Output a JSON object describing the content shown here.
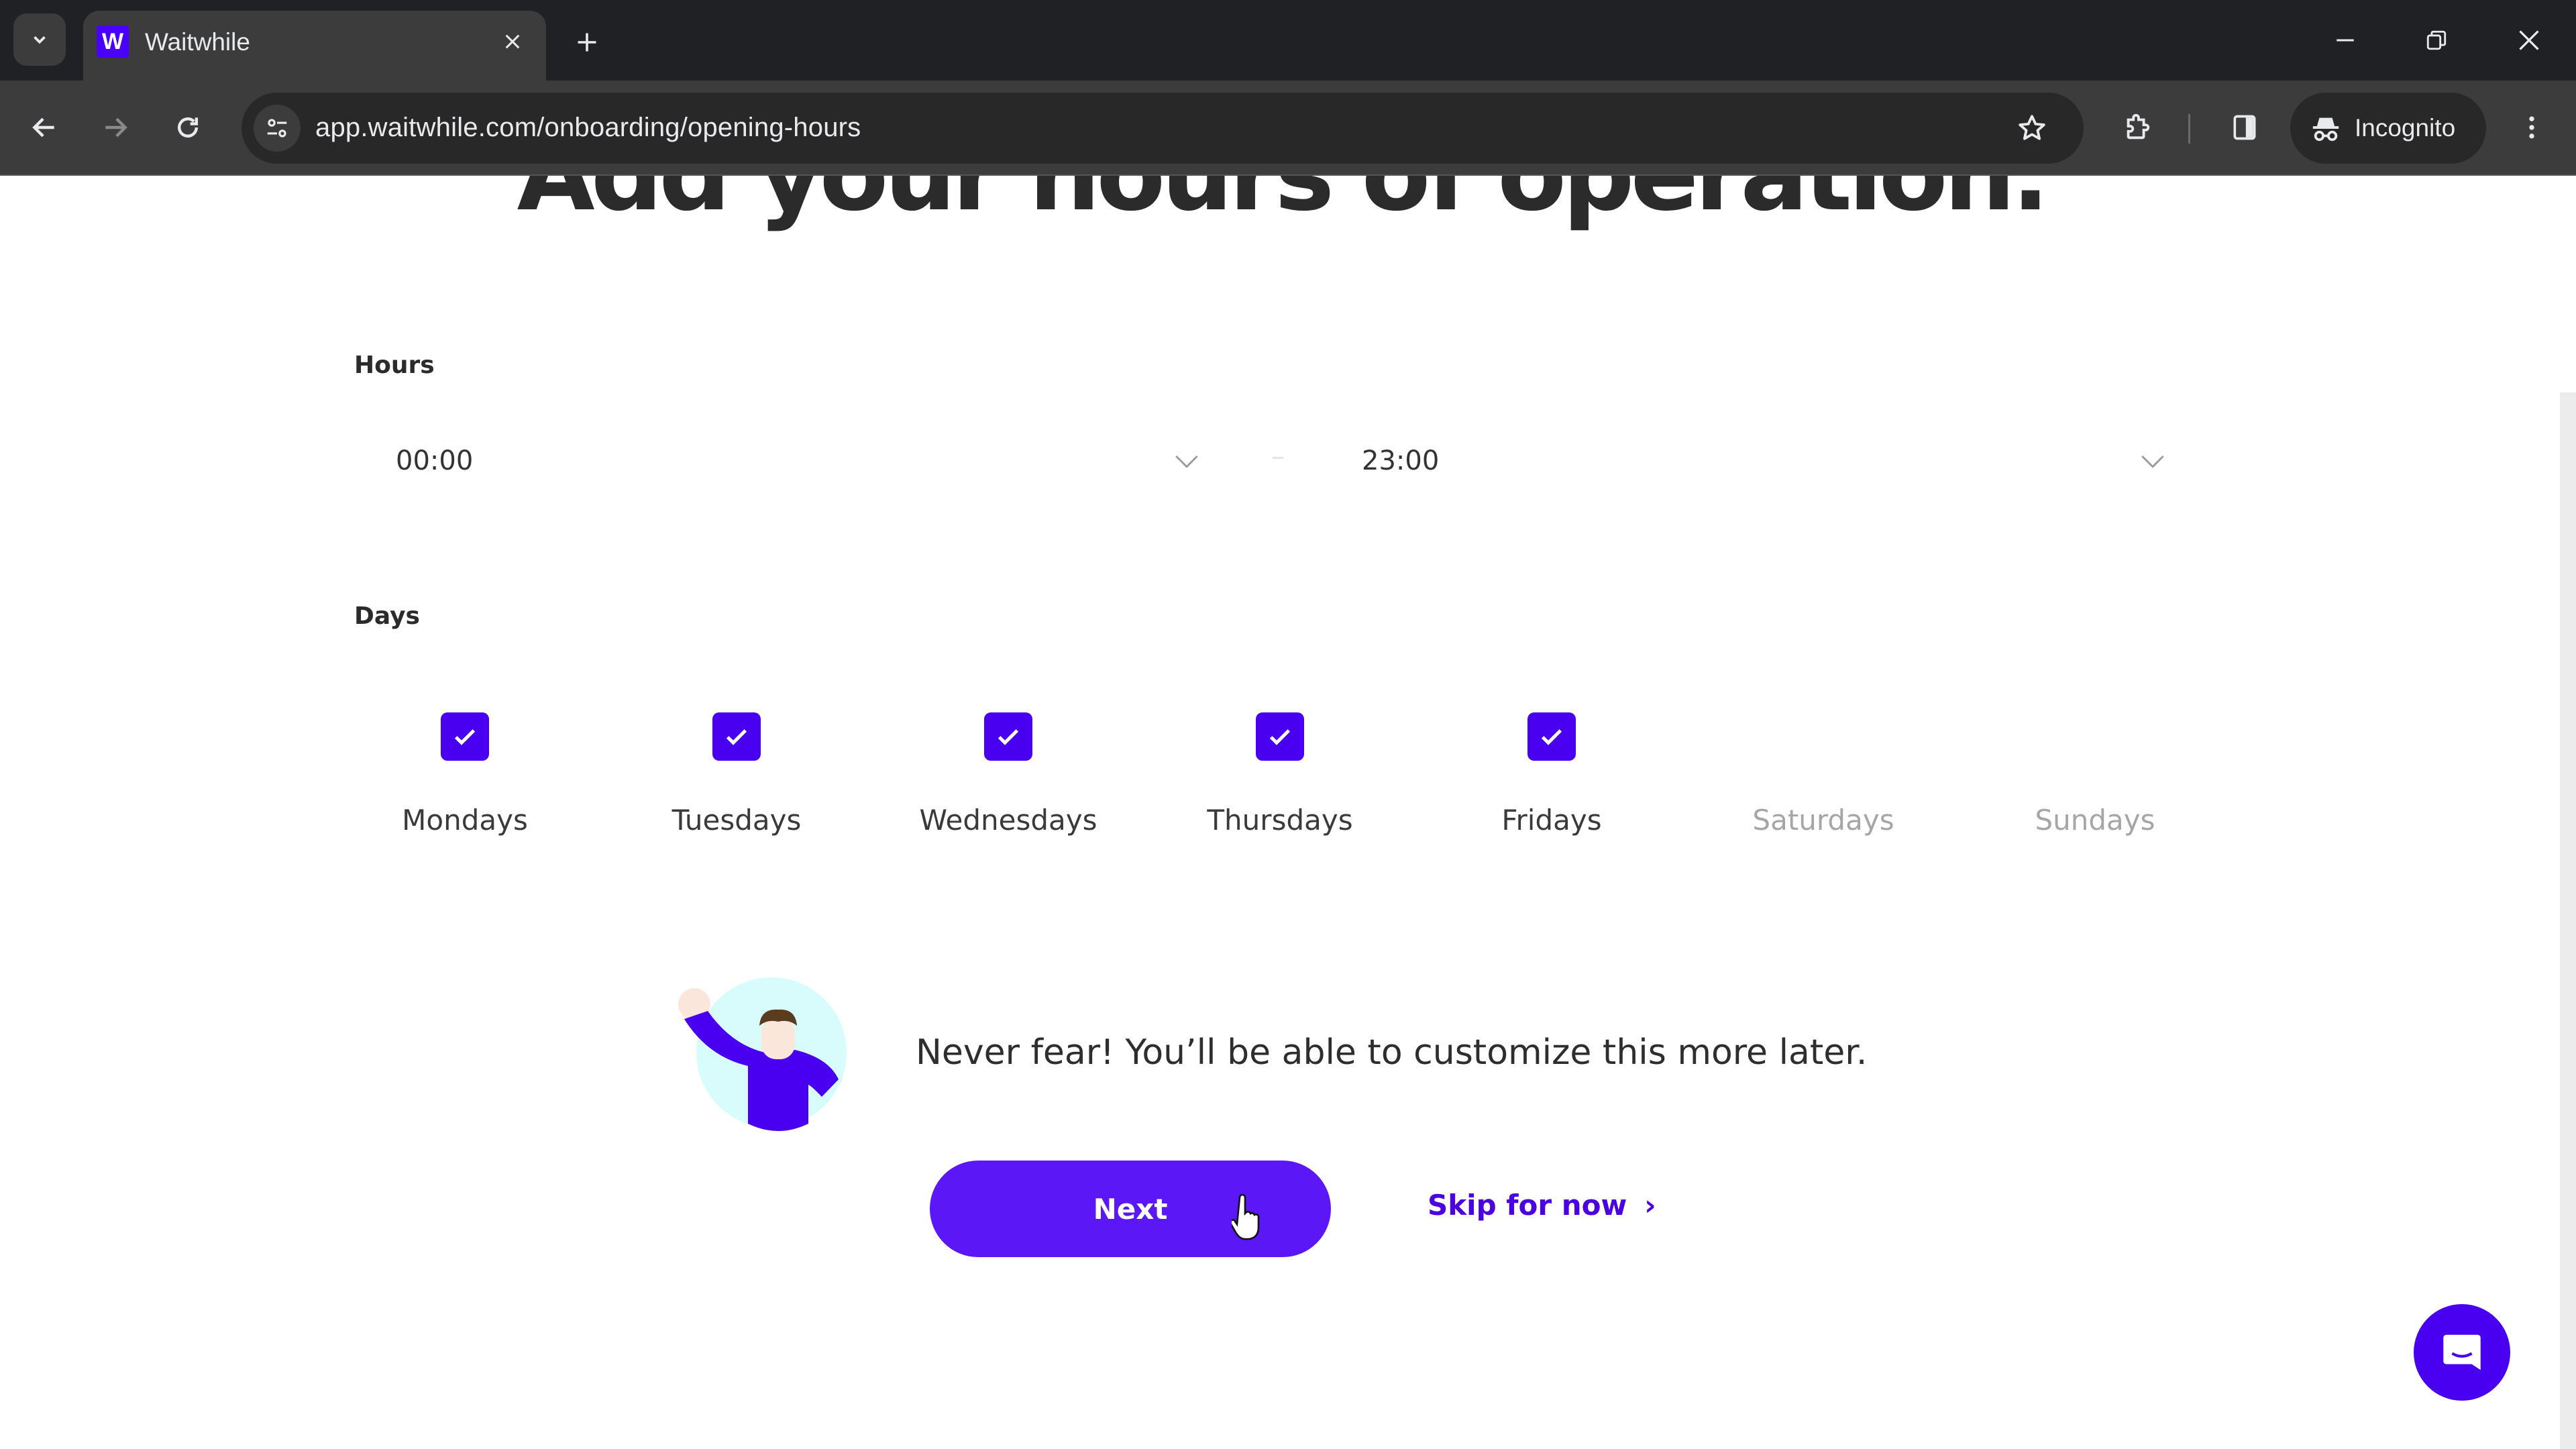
{
  "browser": {
    "tab": {
      "title": "Waitwhile",
      "favicon_letter": "W"
    },
    "url": "app.waitwhile.com/onboarding/opening-hours",
    "profile_label": "Incognito",
    "icons": [
      "tab-search-icon",
      "close-icon",
      "plus-icon",
      "minimize-icon",
      "restore-icon",
      "window-close-icon",
      "back-arrow-icon",
      "forward-arrow-icon",
      "reload-icon",
      "site-info-icon",
      "star-icon",
      "extensions-icon",
      "side-panel-icon",
      "incognito-icon",
      "kebab-menu-icon"
    ]
  },
  "page": {
    "title": "Add your hours of operation.",
    "hours": {
      "label": "Hours",
      "start": "00:00",
      "end": "23:00"
    },
    "days": {
      "label": "Days",
      "items": [
        {
          "label": "Mondays",
          "checked": true
        },
        {
          "label": "Tuesdays",
          "checked": true
        },
        {
          "label": "Wednesdays",
          "checked": true
        },
        {
          "label": "Thursdays",
          "checked": true
        },
        {
          "label": "Fridays",
          "checked": true
        },
        {
          "label": "Saturdays",
          "checked": false
        },
        {
          "label": "Sundays",
          "checked": false
        }
      ]
    },
    "message": "Never fear! You’ll be able to customize this more later.",
    "next_label": "Next",
    "skip_label": "Skip for now",
    "skip_chevron": "›"
  },
  "colors": {
    "brand": "#4a00f0",
    "button": "#5b17f5",
    "link": "#4a00e0"
  }
}
